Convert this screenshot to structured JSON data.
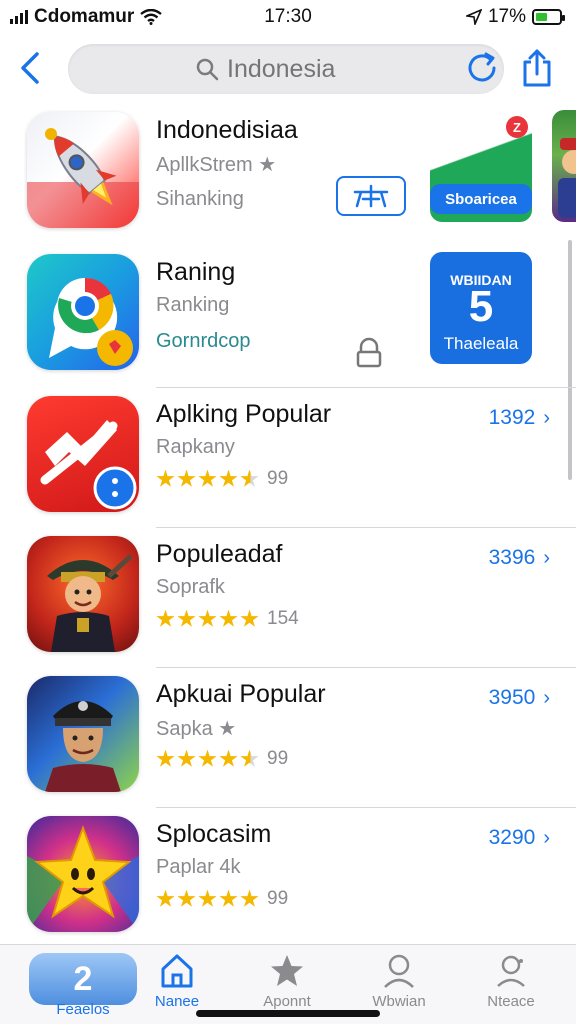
{
  "status_bar": {
    "carrier": "Cdomamur",
    "time": "17:30",
    "battery": "17%",
    "battery_level": 0.5
  },
  "search": {
    "placeholder": "Indonesia",
    "icon": "search-icon"
  },
  "nav": {
    "back_icon": "chevron-left-icon",
    "refresh_icon": "refresh-icon",
    "share_icon": "share-icon"
  },
  "apps": [
    {
      "title": "Indonedisiaa",
      "subtitle": "ApllkStrem ★",
      "third": "Sihanking",
      "icon": "rocket-icon"
    },
    {
      "title": "Raning",
      "subtitle": "Ranking",
      "third": "Gornrdcop",
      "icon": "browser-icon"
    },
    {
      "title": "Aplking Popular",
      "subtitle": "Rapkany",
      "rating": 4.5,
      "rating_count": "99",
      "rank": "1392",
      "icon": "red-app-icon"
    },
    {
      "title": "Populeadaf",
      "subtitle": "Soprafk",
      "rating": 5,
      "rating_count": "154",
      "rank": "3396",
      "icon": "pirate-game-icon"
    },
    {
      "title": "Apkuai Popular",
      "subtitle": "Sapka ★",
      "rating": 4.5,
      "rating_count": "99",
      "rank": "3950",
      "icon": "hero-game-icon"
    },
    {
      "title": "Splocasim",
      "subtitle": "Paplar 4k",
      "rating": 5,
      "rating_count": "99",
      "rank": "3290",
      "icon": "star-game-icon"
    }
  ],
  "promos": {
    "card1_label": "Sboaricea",
    "card1_badge": "Z",
    "card2_top": "WBIIDAN",
    "card2_digit": "5",
    "card2_label": "Thaeleala"
  },
  "tabs": [
    {
      "label": "Feaelos",
      "badge": "2",
      "icon": "featured-icon",
      "active": false
    },
    {
      "label": "Nanee",
      "icon": "home-icon",
      "active": true
    },
    {
      "label": "Aponnt",
      "icon": "star-icon",
      "active": false
    },
    {
      "label": "Wbwian",
      "icon": "search-person-icon",
      "active": false
    },
    {
      "label": "Nteace",
      "icon": "account-icon",
      "active": false
    }
  ],
  "colors": {
    "accent": "#1a73e8",
    "star": "#f5b800"
  }
}
